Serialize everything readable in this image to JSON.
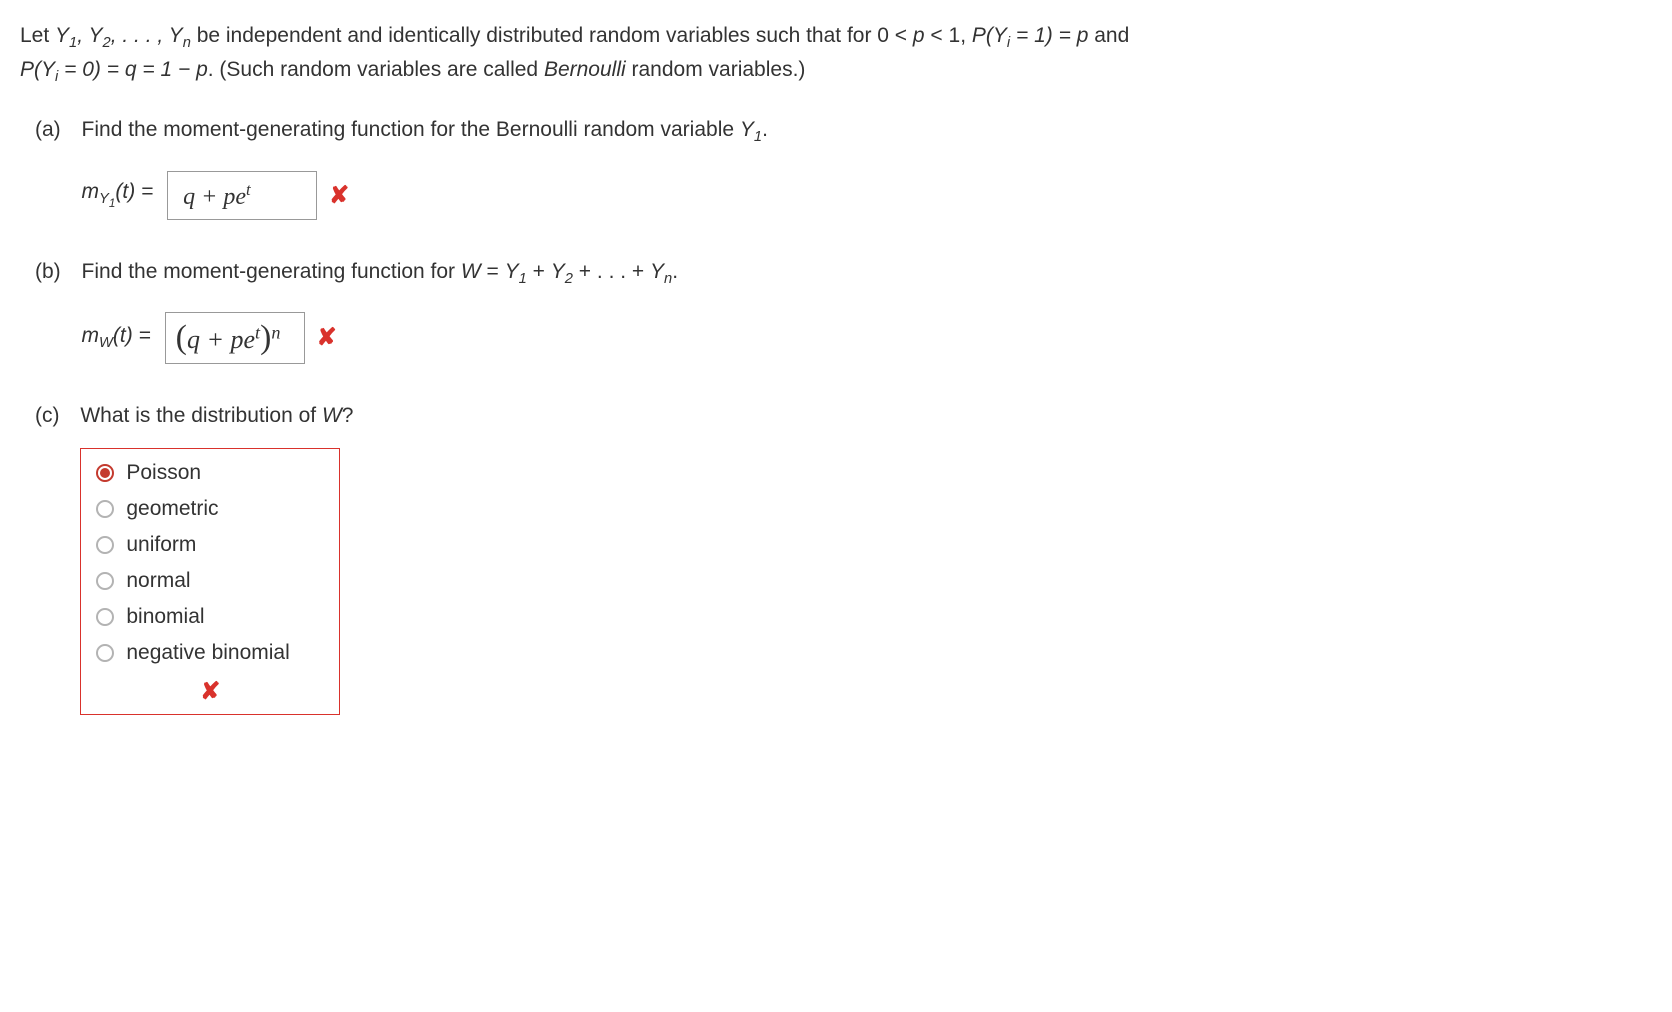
{
  "problem": {
    "intro_part1": "Let ",
    "intro_vars": "Y₁, Y₂, . . . , Yₙ",
    "intro_part2": " be independent and identically distributed random variables such that for 0 < ",
    "intro_part3": " < 1, ",
    "intro_prob1": "P(Yᵢ = 1) = p",
    "intro_part4": " and ",
    "intro_prob2": "P(Yᵢ = 0) = q = 1 − p",
    "intro_part5": ". (Such random variables are called ",
    "intro_bernoulli": "Bernoulli",
    "intro_part6": " random variables.)"
  },
  "parts": {
    "a": {
      "label": "(a)",
      "question": "Find the moment-generating function for the Bernoulli random variable Y₁.",
      "answer_label_prefix": "m",
      "answer_label_sub": "Y₁",
      "answer_label_suffix": "(t) = ",
      "answer_value": "q + peᵗ"
    },
    "b": {
      "label": "(b)",
      "question_prefix": "Find the moment-generating function for ",
      "question_var": "W = Y₁ + Y₂ + . . . + Yₙ",
      "question_suffix": ".",
      "answer_label_prefix": "m",
      "answer_label_sub": "W",
      "answer_label_suffix": "(t) = ",
      "answer_value": "(q + peᵗ)ⁿ"
    },
    "c": {
      "label": "(c)",
      "question": "What is the distribution of W?",
      "options": [
        {
          "label": "Poisson",
          "selected": true
        },
        {
          "label": "geometric",
          "selected": false
        },
        {
          "label": "uniform",
          "selected": false
        },
        {
          "label": "normal",
          "selected": false
        },
        {
          "label": "binomial",
          "selected": false
        },
        {
          "label": "negative binomial",
          "selected": false
        }
      ]
    }
  },
  "icons": {
    "incorrect": "✘"
  }
}
